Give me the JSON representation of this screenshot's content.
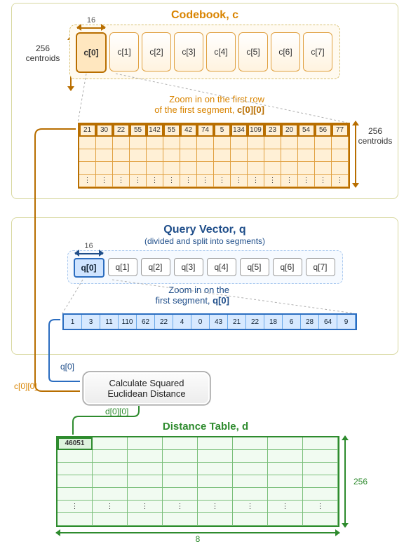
{
  "codebook": {
    "title": "Codebook, c",
    "dim16": "16",
    "centroids_label": "256\ncentroids",
    "segments": [
      "c[0]",
      "c[1]",
      "c[2]",
      "c[3]",
      "c[4]",
      "c[5]",
      "c[6]",
      "c[7]"
    ],
    "zoom_caption_line1": "Zoom in on the first row",
    "zoom_caption_line2": "of the first segment, ",
    "zoom_caption_bold": "c[0][0]",
    "row0": [
      21,
      30,
      22,
      55,
      142,
      55,
      42,
      74,
      5,
      134,
      109,
      23,
      20,
      54,
      56,
      77
    ],
    "centroids_label2": "256\ncentroids"
  },
  "query": {
    "title": "Query Vector, q",
    "subtitle": "(divided and split into segments)",
    "dim16": "16",
    "segments": [
      "q[0]",
      "q[1]",
      "q[2]",
      "q[3]",
      "q[4]",
      "q[5]",
      "q[6]",
      "q[7]"
    ],
    "zoom_caption_line1": "Zoom in on the",
    "zoom_caption_line2": "first segment, ",
    "zoom_caption_bold": "q[0]",
    "row": [
      1,
      3,
      11,
      110,
      62,
      22,
      4,
      0,
      43,
      21,
      22,
      18,
      6,
      28,
      64,
      9
    ]
  },
  "flow": {
    "q_label": "q[0]",
    "c_label": "c[0][0]",
    "calc_line1": "Calculate Squared",
    "calc_line2": "Euclidean Distance",
    "d_label": "d[0][0]"
  },
  "distance": {
    "title": "Distance Table, d",
    "value": 46051,
    "rows_label": "256",
    "cols_label": "8"
  }
}
